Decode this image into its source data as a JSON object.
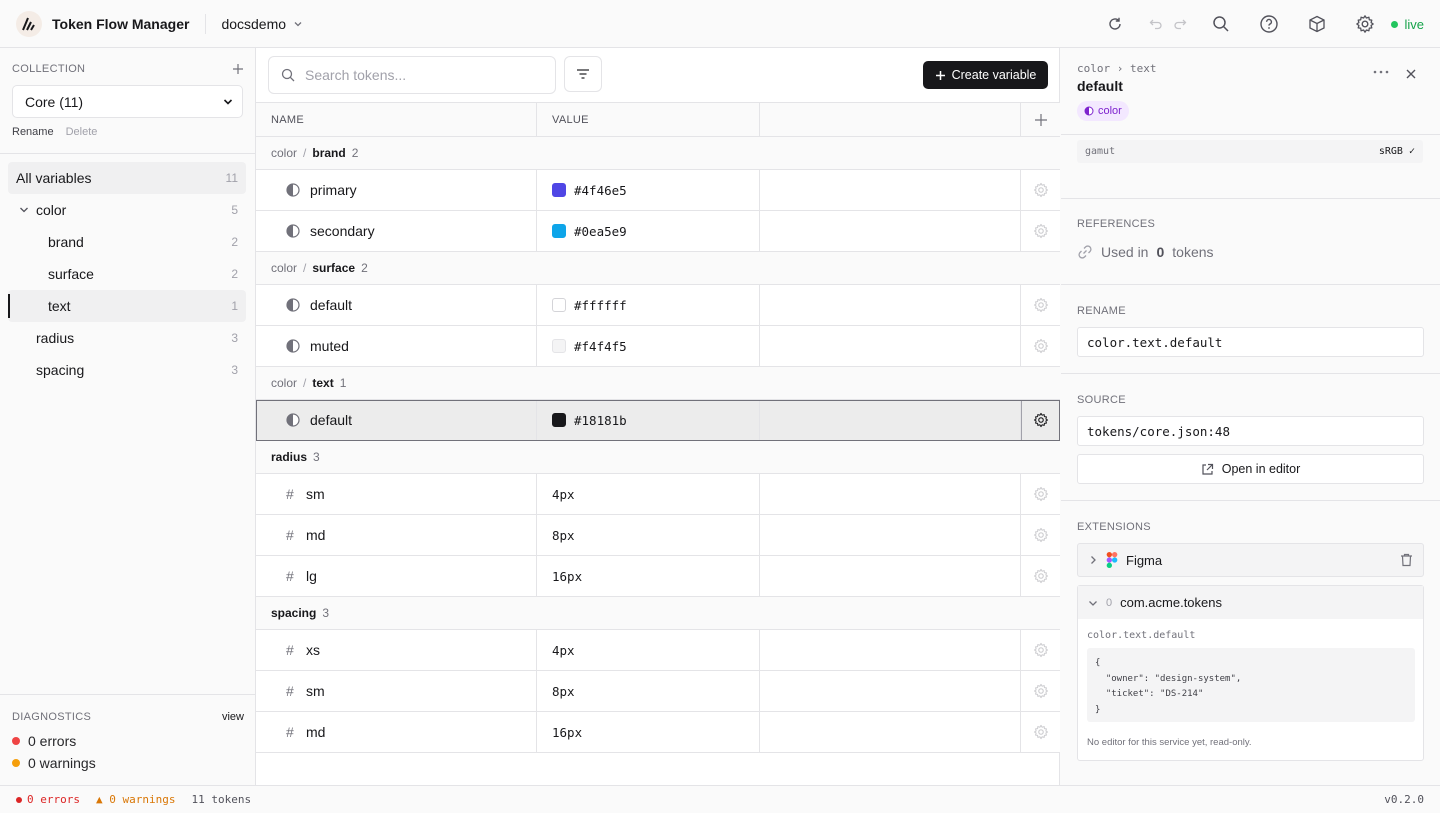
{
  "app": {
    "title": "Token Flow Manager",
    "project": "docsdemo",
    "live_label": "live"
  },
  "sidebar": {
    "collection_label": "COLLECTION",
    "collection_value": "Core (11)",
    "rename_label": "Rename",
    "delete_label": "Delete",
    "all_label": "All variables",
    "all_count": "11",
    "tree": [
      {
        "label": "color",
        "count": "5"
      },
      {
        "label": "brand",
        "count": "2"
      },
      {
        "label": "surface",
        "count": "2"
      },
      {
        "label": "text",
        "count": "1"
      },
      {
        "label": "radius",
        "count": "3"
      },
      {
        "label": "spacing",
        "count": "3"
      }
    ],
    "diagnostics_label": "DIAGNOSTICS",
    "view_label": "view",
    "errors": "0 errors",
    "warnings": "0 warnings"
  },
  "main": {
    "search_placeholder": "Search tokens...",
    "create_label": "Create variable",
    "col_name": "NAME",
    "col_value": "VALUE",
    "groups": [
      {
        "prefix": "color",
        "sep": "/",
        "name": "brand",
        "count": "2",
        "rows": [
          {
            "name": "primary",
            "value": "#4f46e5",
            "swatch": "#4f46e5"
          },
          {
            "name": "secondary",
            "value": "#0ea5e9",
            "swatch": "#0ea5e9"
          }
        ]
      },
      {
        "prefix": "color",
        "sep": "/",
        "name": "surface",
        "count": "2",
        "rows": [
          {
            "name": "default",
            "value": "#ffffff",
            "swatch": "#ffffff"
          },
          {
            "name": "muted",
            "value": "#f4f4f5",
            "swatch": "#f4f4f5"
          }
        ]
      },
      {
        "prefix": "color",
        "sep": "/",
        "name": "text",
        "count": "1",
        "rows": [
          {
            "name": "default",
            "value": "#18181b",
            "swatch": "#18181b"
          }
        ]
      },
      {
        "name": "radius",
        "count": "3",
        "rows": [
          {
            "name": "sm",
            "value": "4px"
          },
          {
            "name": "md",
            "value": "8px"
          },
          {
            "name": "lg",
            "value": "16px"
          }
        ]
      },
      {
        "name": "spacing",
        "count": "3",
        "rows": [
          {
            "name": "xs",
            "value": "4px"
          },
          {
            "name": "sm",
            "value": "8px"
          },
          {
            "name": "md",
            "value": "16px"
          }
        ]
      }
    ]
  },
  "panel": {
    "crumb": "color › text",
    "title": "default",
    "type_badge": "color",
    "gamut_label": "gamut",
    "gamut_value": "sRGB ✓",
    "references_label": "REFERENCES",
    "used_prefix": "Used in",
    "used_count": "0",
    "used_suffix": "tokens",
    "rename_label": "RENAME",
    "rename_value": "color.text.default",
    "source_label": "SOURCE",
    "source_value": "tokens/core.json:48",
    "open_editor_label": "Open in editor",
    "extensions_label": "EXTENSIONS",
    "figma_label": "Figma",
    "acme_count": "0",
    "acme_label": "com.acme.tokens",
    "acme_path": "color.text.default",
    "acme_code": "{\n  \"owner\": \"design-system\",\n  \"ticket\": \"DS-214\"\n}",
    "acme_note": "No editor for this service yet, read-only."
  },
  "statusbar": {
    "errors": "0 errors",
    "warnings": "▲ 0 warnings",
    "tokens": "11 tokens",
    "version": "v0.2.0"
  },
  "colors": {
    "accent": "#18181b",
    "live": "#22c55e",
    "error": "#dc2626",
    "warning": "#d97706"
  }
}
